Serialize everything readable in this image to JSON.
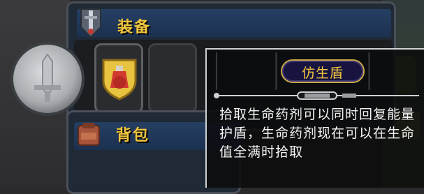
{
  "equipment": {
    "title": "装备",
    "slots": [
      {
        "icon": "sword-emblem-icon"
      },
      {
        "icon": "potion-shield-icon"
      },
      {
        "icon": "empty-slot"
      }
    ]
  },
  "backpack": {
    "title": "背包"
  },
  "tooltip": {
    "title": "仿生盾",
    "description": "拾取生命药剂可以同时回复能量护盾，生命药剂现在可以在生命值全满时拾取"
  },
  "colors": {
    "title_gold": "#f0c53e",
    "panel_blue": "#253f63",
    "potion_red": "#d23a2f"
  }
}
